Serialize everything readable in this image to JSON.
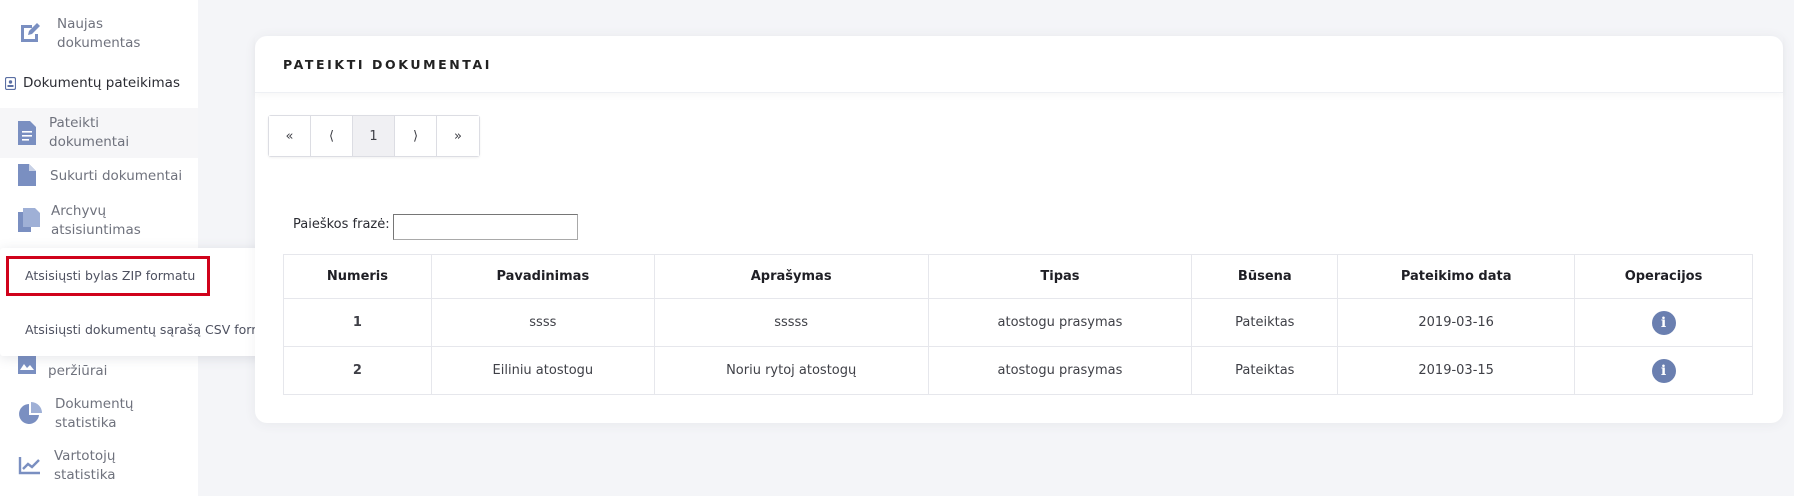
{
  "sidebar": {
    "items": [
      {
        "label": "Naujas dokumentas",
        "icon": "edit-document-icon"
      },
      {
        "label": "Pateikti dokumentai",
        "icon": "document-icon"
      },
      {
        "label": "Sukurti dokumentai",
        "icon": "file-icon"
      },
      {
        "label": "Archyvų atsisiuntimas",
        "icon": "copy-icon"
      },
      {
        "label": "peržiūrai",
        "icon": "image-document-icon"
      },
      {
        "label": "Dokumentų statistika",
        "icon": "pie-chart-icon"
      },
      {
        "label": "Vartotojų statistika",
        "icon": "line-chart-icon"
      }
    ],
    "section_label": "Dokumentų pateikimas"
  },
  "dropdown": {
    "items": [
      "Atsisiųsti bylas ZIP formatu",
      "Atsisiųsti dokumentų sąrašą CSV formatu"
    ],
    "highlight_color": "#d0021b"
  },
  "card": {
    "title": "PATEIKTI DOKUMENTAI",
    "pager": [
      "«",
      "⟨",
      "1",
      "⟩",
      "»"
    ],
    "search_label": "Paieškos frazė:",
    "search_value": "",
    "table": {
      "headers": [
        "Numeris",
        "Pavadinimas",
        "Aprašymas",
        "Tipas",
        "Būsena",
        "Pateikimo data",
        "Operacijos"
      ],
      "rows": [
        [
          "1",
          "ssss",
          "sssss",
          "atostogu prasymas",
          "Pateiktas",
          "2019-03-16"
        ],
        [
          "2",
          "Eiliniu atostogu",
          "Noriu rytoj atostogų",
          "atostogu prasymas",
          "Pateiktas",
          "2019-03-15"
        ]
      ]
    }
  },
  "colors": {
    "icon": "#7a8fc1",
    "info_button": "#6a7fb0",
    "background": "#f4f5f8"
  }
}
